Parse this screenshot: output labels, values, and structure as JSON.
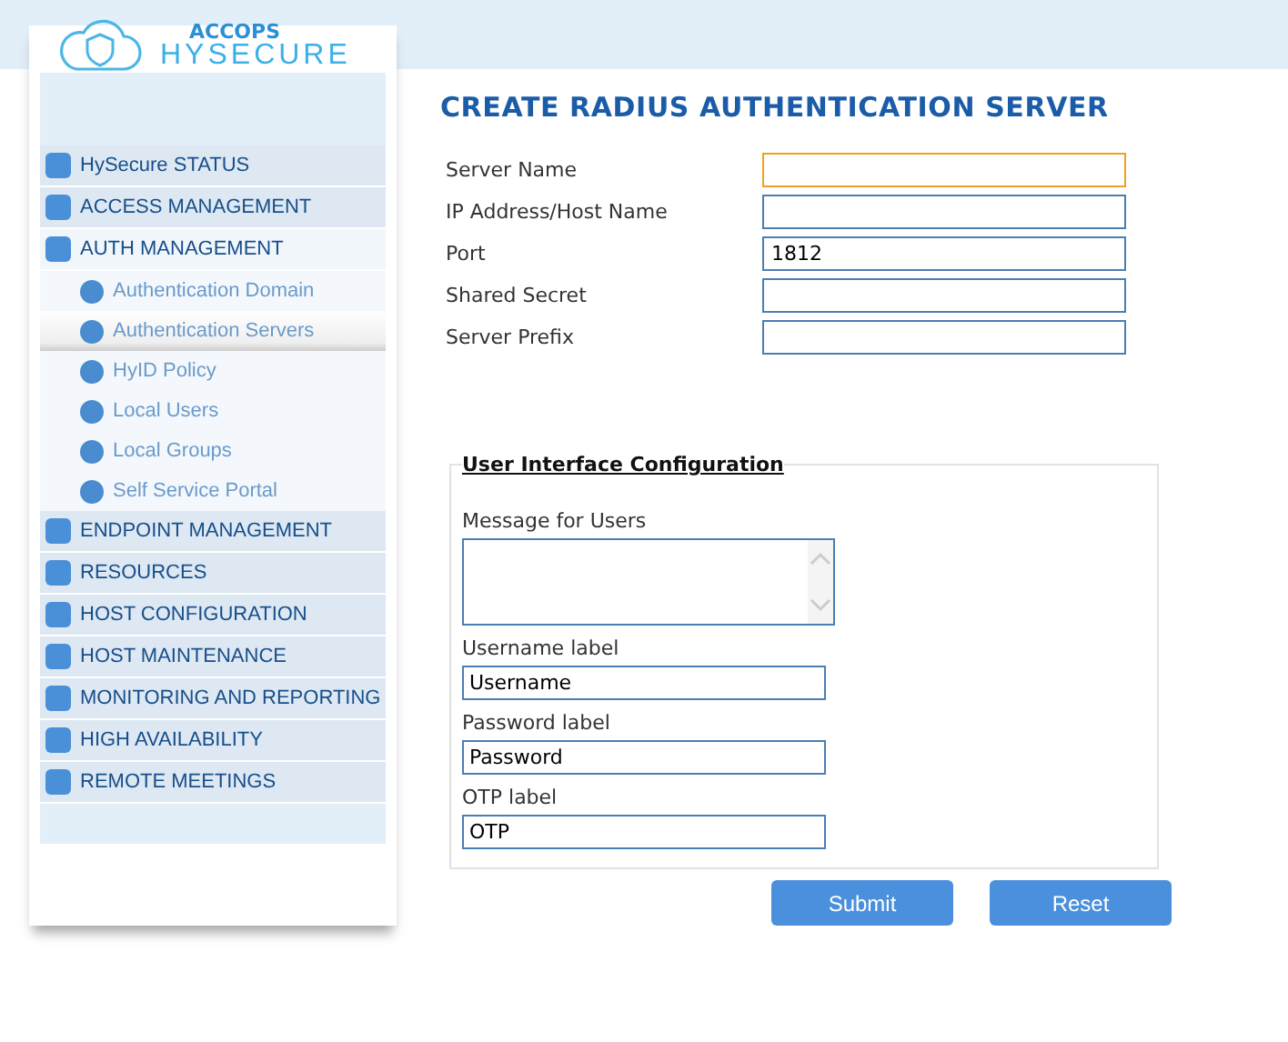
{
  "logo": {
    "brand": "ACCOPS",
    "product": "HYSECURE"
  },
  "sidebar": {
    "items": [
      {
        "label": "HySecure STATUS",
        "expanded": false
      },
      {
        "label": "ACCESS MANAGEMENT",
        "expanded": false
      },
      {
        "label": "AUTH MANAGEMENT",
        "expanded": true,
        "children": [
          {
            "label": "Authentication Domain",
            "selected": false
          },
          {
            "label": "Authentication Servers",
            "selected": true
          },
          {
            "label": "HyID Policy",
            "selected": false
          },
          {
            "label": "Local Users",
            "selected": false
          },
          {
            "label": "Local Groups",
            "selected": false
          },
          {
            "label": "Self Service Portal",
            "selected": false
          }
        ]
      },
      {
        "label": "ENDPOINT MANAGEMENT",
        "expanded": false
      },
      {
        "label": "RESOURCES",
        "expanded": false
      },
      {
        "label": "HOST CONFIGURATION",
        "expanded": false
      },
      {
        "label": "HOST MAINTENANCE",
        "expanded": false
      },
      {
        "label": "MONITORING AND REPORTING",
        "expanded": false
      },
      {
        "label": "HIGH AVAILABILITY",
        "expanded": false
      },
      {
        "label": "REMOTE MEETINGS",
        "expanded": false
      }
    ]
  },
  "page_title": "CREATE RADIUS AUTHENTICATION SERVER",
  "fields": [
    {
      "label": "Server Name",
      "focused": true
    },
    {
      "label": "IP Address/Host Name",
      "focused": false
    },
    {
      "label": "Port",
      "value": "1812",
      "focused": false
    },
    {
      "label": "Shared Secret",
      "focused": false
    },
    {
      "label": "Server Prefix",
      "focused": false
    }
  ],
  "ui_config": {
    "legend": "User Interface Configuration",
    "message_label": "Message for Users",
    "fields": [
      {
        "label": "Username label",
        "value": "Username"
      },
      {
        "label": "Password label",
        "value": "Password"
      },
      {
        "label": "OTP label",
        "value": "OTP"
      }
    ]
  },
  "buttons": [
    "Submit",
    "Reset"
  ]
}
